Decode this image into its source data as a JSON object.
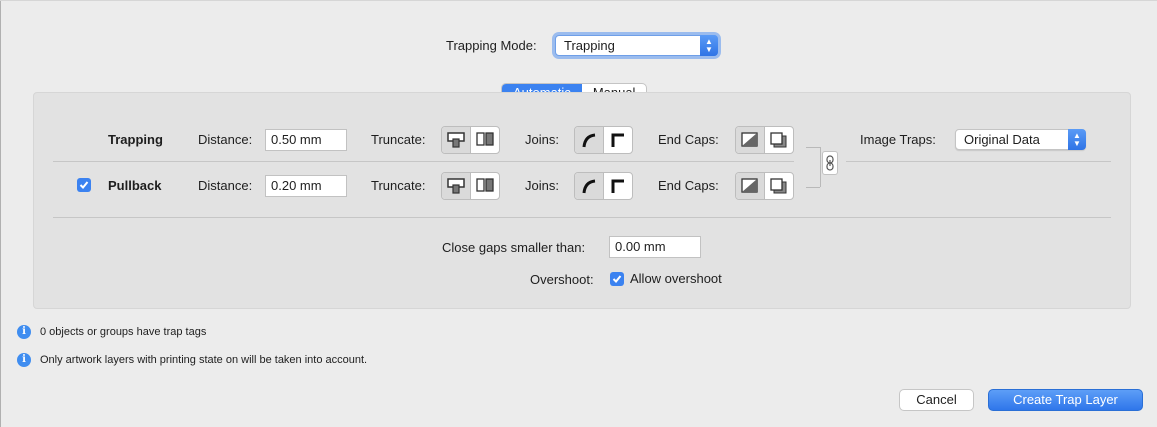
{
  "header": {
    "trapping_mode_label": "Trapping Mode:",
    "trapping_mode_value": "Trapping"
  },
  "tabs": [
    {
      "label": "Automatic",
      "active": true
    },
    {
      "label": "Manual",
      "active": false
    }
  ],
  "rows": {
    "trapping": {
      "title": "Trapping",
      "distance_label": "Distance:",
      "distance_value": "0.50 mm",
      "truncate_label": "Truncate:",
      "joins_label": "Joins:",
      "end_caps_label": "End Caps:"
    },
    "pullback": {
      "checked": true,
      "title": "Pullback",
      "distance_label": "Distance:",
      "distance_value": "0.20 mm",
      "truncate_label": "Truncate:",
      "joins_label": "Joins:",
      "end_caps_label": "End Caps:"
    }
  },
  "image_traps": {
    "label": "Image Traps:",
    "value": "Original Data"
  },
  "close_gaps": {
    "label": "Close gaps smaller than:",
    "value": "0.00 mm"
  },
  "overshoot": {
    "label": "Overshoot:",
    "checkbox_label": "Allow overshoot",
    "checked": true
  },
  "info": [
    "0 objects or groups have trap tags",
    "Only artwork layers with printing state on will be taken into account."
  ],
  "buttons": {
    "cancel": "Cancel",
    "create": "Create Trap Layer"
  },
  "icons": {
    "info": "info-icon",
    "checkmark": "checkmark-icon",
    "link": "link-chain-icon",
    "popup_arrows": "chevron-updown-icon"
  },
  "colors": {
    "accent": "#3b82f0",
    "background": "#ececec",
    "group": "#e2e2e2"
  }
}
